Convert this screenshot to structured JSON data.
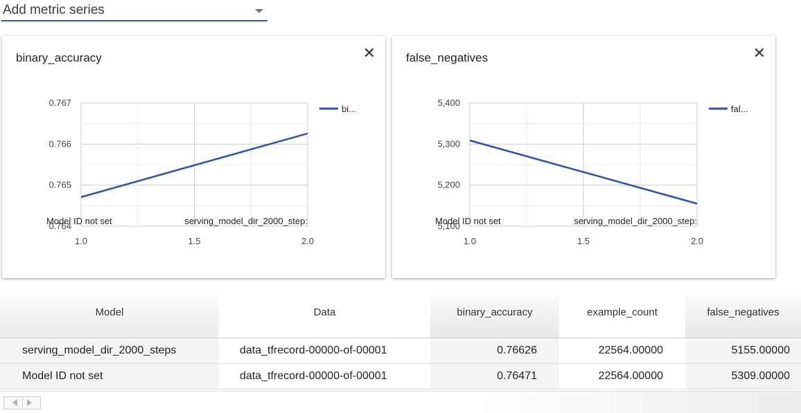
{
  "metric_select": {
    "label": "Add metric series"
  },
  "close_glyph": "✕",
  "table": {
    "columns": [
      "Model",
      "Data",
      "binary_accuracy",
      "example_count",
      "false_negatives"
    ],
    "rows": [
      [
        "serving_model_dir_2000_steps",
        "data_tfrecord-00000-of-00001",
        "0.76626",
        "22564.00000",
        "5155.00000"
      ],
      [
        "Model ID not set",
        "data_tfrecord-00000-of-00001",
        "0.76471",
        "22564.00000",
        "5309.00000"
      ]
    ]
  },
  "chart_data": [
    {
      "type": "line",
      "title": "binary_accuracy",
      "x": [
        1.0,
        2.0
      ],
      "x_tick_labels": [
        "1.0",
        "1.5",
        "2.0"
      ],
      "x_ticks": [
        1.0,
        1.5,
        2.0
      ],
      "y_tick_labels": [
        "0.764",
        "0.765",
        "0.766",
        "0.767"
      ],
      "y_ticks": [
        0.764,
        0.765,
        0.766,
        0.767
      ],
      "ylim": [
        0.764,
        0.767
      ],
      "xlim": [
        1.0,
        2.0
      ],
      "point_labels": [
        "Model ID not set",
        "serving_model_dir_2000_step:"
      ],
      "series": [
        {
          "legend_label": "bi...",
          "values": [
            0.76471,
            0.76626
          ]
        }
      ],
      "legend_position": "top-right",
      "grid": true,
      "color": "#2b4fb5"
    },
    {
      "type": "line",
      "title": "false_negatives",
      "x": [
        1.0,
        2.0
      ],
      "x_tick_labels": [
        "1.0",
        "1.5",
        "2.0"
      ],
      "x_ticks": [
        1.0,
        1.5,
        2.0
      ],
      "y_tick_labels": [
        "5,100",
        "5,200",
        "5,300",
        "5,400"
      ],
      "y_ticks": [
        5100,
        5200,
        5300,
        5400
      ],
      "ylim": [
        5100,
        5400
      ],
      "xlim": [
        1.0,
        2.0
      ],
      "point_labels": [
        "Model ID not set",
        "serving_model_dir_2000_step:"
      ],
      "series": [
        {
          "legend_label": "fal...",
          "values": [
            5309,
            5155
          ]
        }
      ],
      "legend_position": "top-right",
      "grid": true,
      "color": "#2b4fb5"
    }
  ]
}
